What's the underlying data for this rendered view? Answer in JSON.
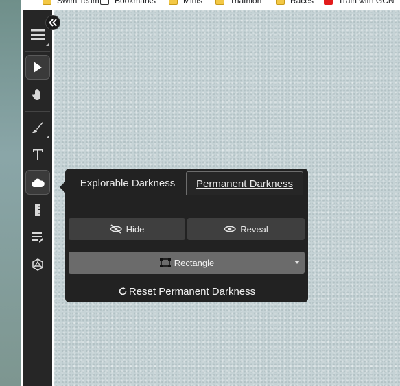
{
  "bookmarks": [
    {
      "label": "Swim Team",
      "icon": "folder-icon"
    },
    {
      "label": "Bookmarks",
      "icon": "page-icon"
    },
    {
      "label": "Minis",
      "icon": "folder-icon"
    },
    {
      "label": "Triathlon",
      "icon": "folder-icon"
    },
    {
      "label": "Races",
      "icon": "folder-icon"
    },
    {
      "label": "Train with GCN",
      "icon": "youtube-icon"
    }
  ],
  "toolbar": {
    "tools": [
      "menu-icon",
      "pointer-icon",
      "hand-icon",
      "brush-icon",
      "text-icon",
      "cloud-icon",
      "ruler-icon",
      "notes-icon",
      "dice-icon"
    ],
    "active": [
      "pointer-icon",
      "cloud-icon"
    ]
  },
  "darkness_panel": {
    "tabs": [
      {
        "label": "Explorable Darkness",
        "selected": false
      },
      {
        "label": "Permanent Darkness",
        "selected": true
      }
    ],
    "hide_label": "Hide",
    "reveal_label": "Reveal",
    "shape_label": "Rectangle",
    "reset_label": "Reset Permanent Darkness"
  },
  "colors": {
    "panel_bg": "#222222",
    "button_bg": "#3f3f3f",
    "select_bg": "#6b6b6b",
    "canvas_bg": "#c6d3d6"
  }
}
